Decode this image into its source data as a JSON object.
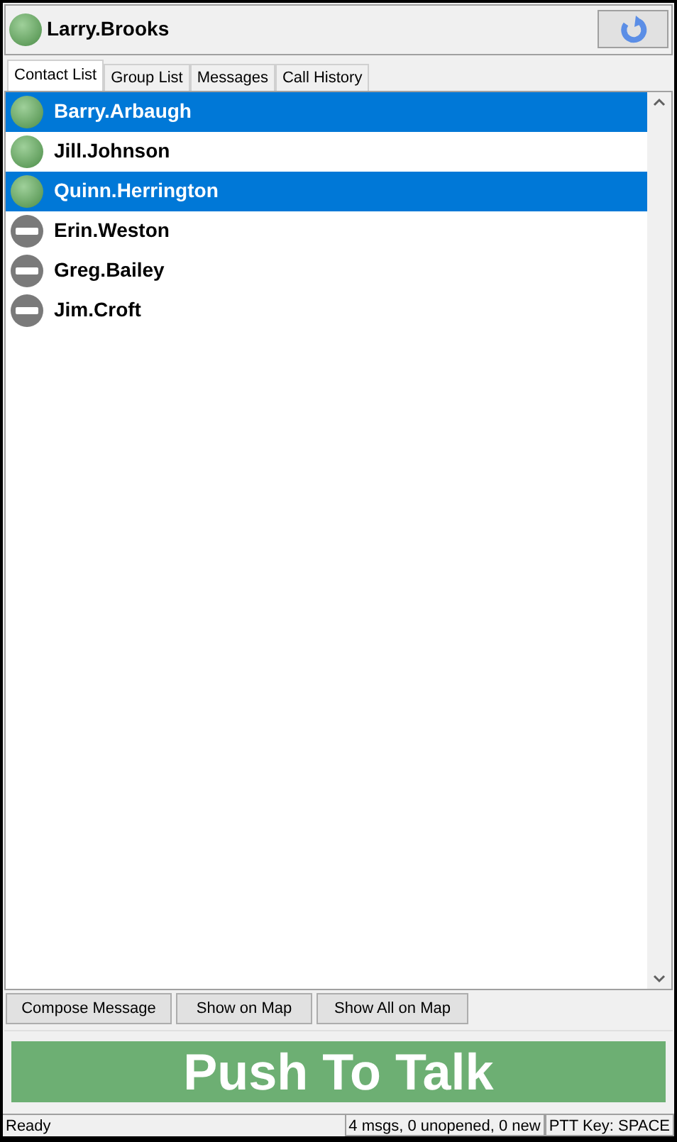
{
  "user": {
    "name": "Larry.Brooks",
    "kind": "online"
  },
  "tabs": [
    {
      "label": "Contact List",
      "selected": true
    },
    {
      "label": "Group List",
      "selected": false
    },
    {
      "label": "Messages",
      "selected": false
    },
    {
      "label": "Call History",
      "selected": false
    }
  ],
  "contacts": [
    {
      "name": "Barry.Arbaugh",
      "kind": "online",
      "selected": true
    },
    {
      "name": "Jill.Johnson",
      "kind": "online",
      "selected": false
    },
    {
      "name": "Quinn.Herrington",
      "kind": "online",
      "selected": true
    },
    {
      "name": "Erin.Weston",
      "kind": "offline",
      "selected": false
    },
    {
      "name": "Greg.Bailey",
      "kind": "offline",
      "selected": false
    },
    {
      "name": "Jim.Croft",
      "kind": "offline",
      "selected": false
    }
  ],
  "buttons": [
    "Compose Message",
    "Show on Map",
    "Show All on Map"
  ],
  "push_to_talk": "Push To Talk",
  "status_bar": [
    "Ready",
    "4 msgs, 0 unopened, 0 new",
    "PTT Key: SPACE"
  ]
}
